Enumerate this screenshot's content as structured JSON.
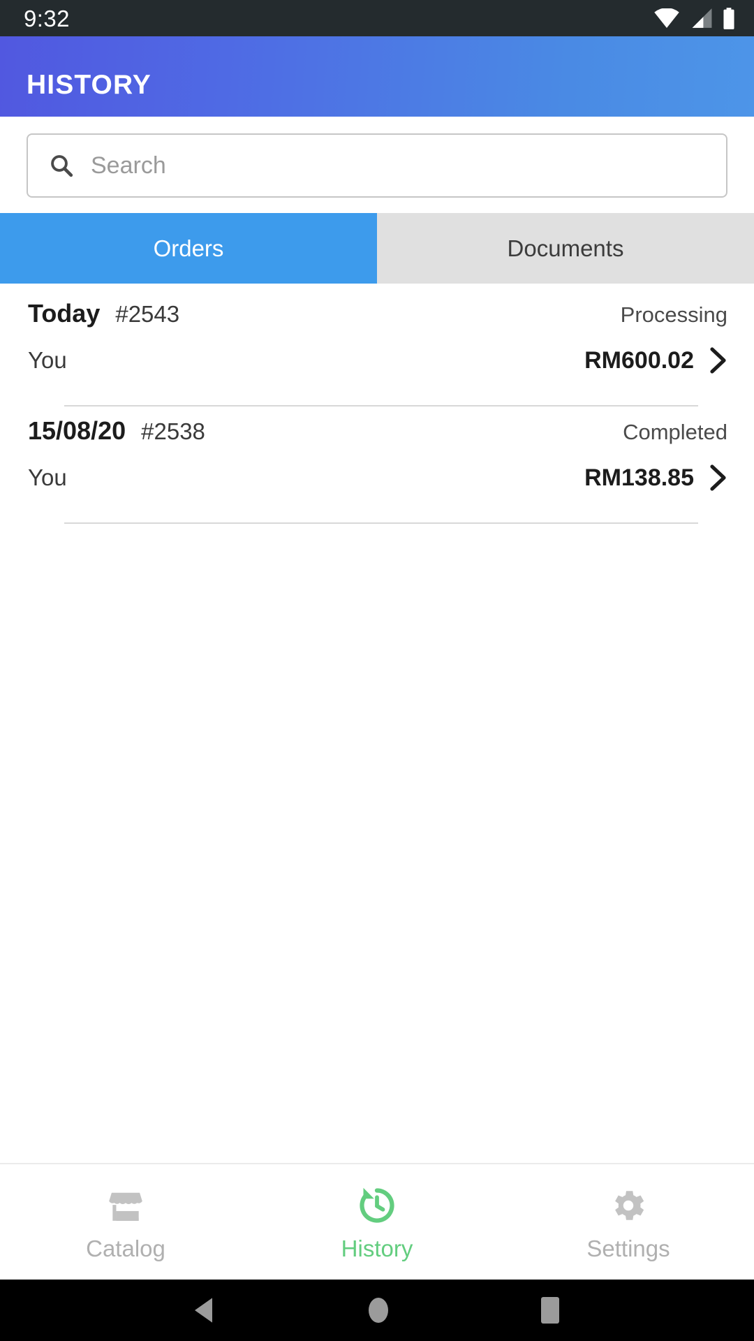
{
  "status_bar": {
    "time": "9:32",
    "icons": [
      "wifi-icon",
      "cellular-signal-icon",
      "battery-icon"
    ]
  },
  "app_bar": {
    "title": "HISTORY",
    "gradient_from": "#5158e0",
    "gradient_to": "#4d95e8"
  },
  "search": {
    "value": "",
    "placeholder": "Search",
    "icon": "search-icon"
  },
  "tabs": {
    "active_index": 0,
    "active_color": "#3d9bec",
    "inactive_color": "#e0e0e0",
    "items": [
      {
        "label": "Orders"
      },
      {
        "label": "Documents"
      }
    ]
  },
  "orders": {
    "items": [
      {
        "date": "Today",
        "number": "#2543",
        "status": "Processing",
        "customer": "You",
        "amount": "RM600.02"
      },
      {
        "date": "15/08/20",
        "number": "#2538",
        "status": "Completed",
        "customer": "You",
        "amount": "RM138.85"
      }
    ]
  },
  "bottom_nav": {
    "active_index": 1,
    "active_color": "#63cd7f",
    "inactive_color": "#b0b0b0",
    "items": [
      {
        "label": "Catalog",
        "icon": "store-icon"
      },
      {
        "label": "History",
        "icon": "history-restore-icon"
      },
      {
        "label": "Settings",
        "icon": "gear-icon"
      }
    ]
  },
  "system_nav": {
    "items": [
      {
        "icon": "back-triangle-icon"
      },
      {
        "icon": "home-circle-icon"
      },
      {
        "icon": "recents-square-icon"
      }
    ]
  }
}
